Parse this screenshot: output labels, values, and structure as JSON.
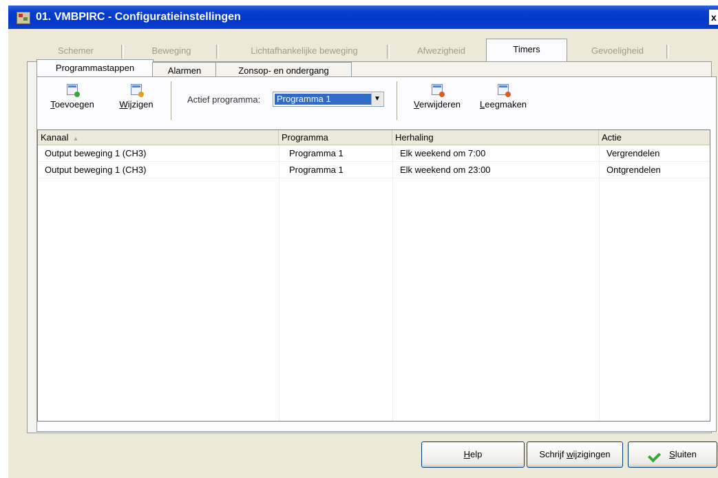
{
  "window": {
    "title": "01. VMBPIRC - Configuratieinstellingen",
    "close_glyph": "x"
  },
  "top_tabs": [
    {
      "label": "Schemer",
      "active": false
    },
    {
      "label": "Beweging",
      "active": false
    },
    {
      "label": "Lichtafhankelijke beweging",
      "active": false
    },
    {
      "label": "Afwezigheid",
      "active": false
    },
    {
      "label": "Timers",
      "active": true
    },
    {
      "label": "Gevoeligheid",
      "active": false
    }
  ],
  "sub_tabs": [
    {
      "label": "Programmastappen",
      "active": true
    },
    {
      "label": "Alarmen",
      "active": false
    },
    {
      "label": "Zonsop- en ondergang",
      "active": false
    }
  ],
  "toolbar": {
    "add": {
      "first": "T",
      "rest": "oevoegen",
      "icon": "add-step-icon"
    },
    "edit": {
      "first": "W",
      "rest": "ijzigen",
      "icon": "edit-step-icon"
    },
    "program_label": "Actief programma:",
    "program_value": "Programma 1",
    "remove": {
      "first": "V",
      "rest": "erwijderen",
      "icon": "remove-step-icon"
    },
    "clear": {
      "first": "L",
      "rest": "eegmaken",
      "icon": "clear-steps-icon"
    }
  },
  "table": {
    "columns": [
      "Kanaal",
      "Programma",
      "Herhaling",
      "Actie"
    ],
    "sort_indicator": "▲",
    "rows": [
      [
        "Output beweging 1 (CH3)",
        "Programma 1",
        "Elk weekend om 7:00",
        "Vergrendelen"
      ],
      [
        "Output beweging 1 (CH3)",
        "Programma 1",
        "Elk weekend om 23:00",
        "Ontgrendelen"
      ]
    ]
  },
  "buttons": {
    "help": {
      "first": "H",
      "rest": "elp"
    },
    "write": {
      "pre": "Schrijf ",
      "first": "w",
      "rest": "ijzigingen"
    },
    "close": {
      "first": "S",
      "rest": "luiten"
    }
  },
  "colors": {
    "titlebar": "#0a3fd0",
    "selection": "#316ac5",
    "add_badge": "#3aa53a",
    "edit_badge": "#e0a020",
    "remove_badge": "#e05a1e"
  }
}
